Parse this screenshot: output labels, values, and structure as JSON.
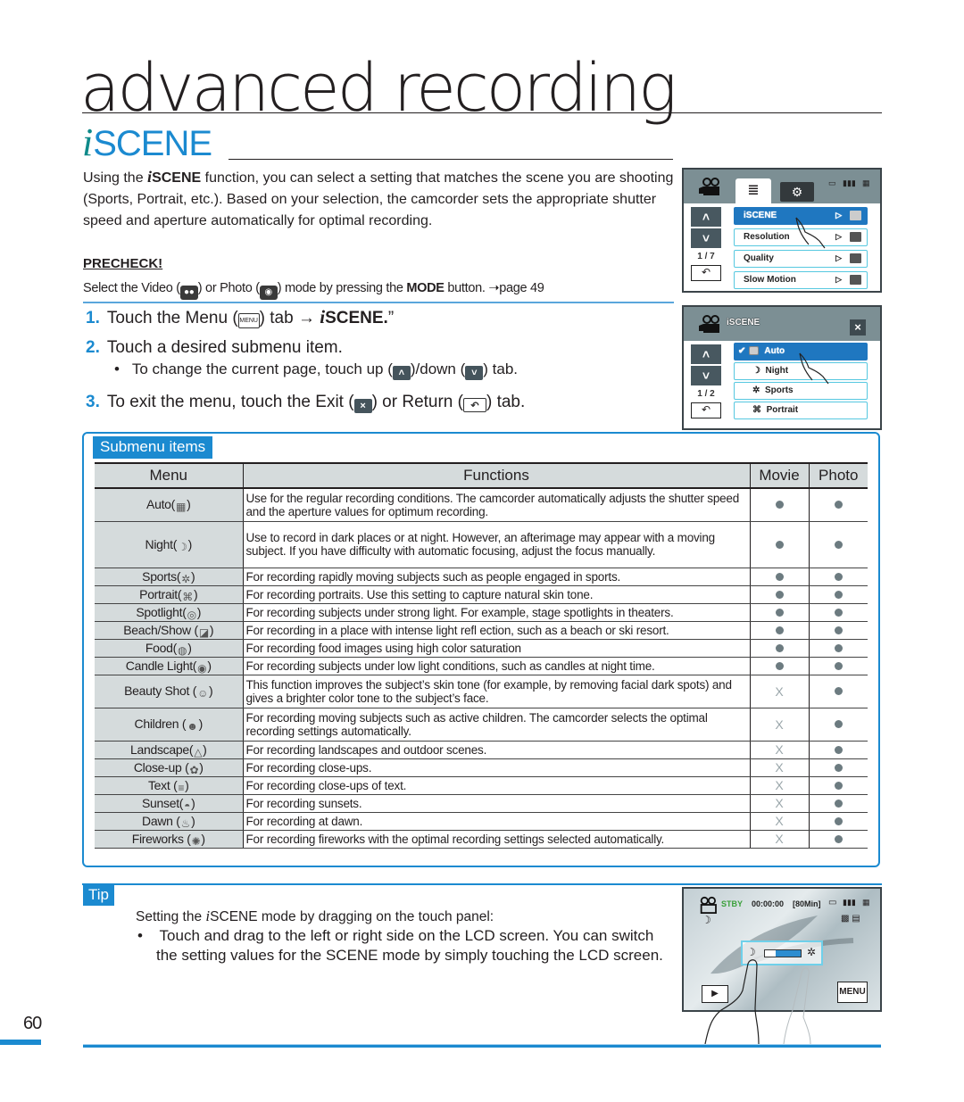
{
  "chapter_title": "advanced recording",
  "section": {
    "prefix": "i",
    "title": "SCENE"
  },
  "intro": {
    "part1": "Using the ",
    "brand_i": "i",
    "brand": "SCENE",
    "part2": " function, you can select a setting that matches the scene you are shooting (Sports, Portrait, etc.). Based on your selection, the camcorder sets the appropriate shutter speed and aperture automatically for optimal recording."
  },
  "precheck": {
    "title": "PRECHECK!",
    "text1": "Select the Video (",
    "video_icon": "video-camera-icon",
    "text2": ") or Photo (",
    "photo_icon": "camera-icon",
    "text3": ") mode by pressing the ",
    "mode": "MODE",
    "text4": " button. ",
    "page_ref": "➝page 49"
  },
  "steps": [
    {
      "num": "1.",
      "text1": "Touch the Menu (",
      "menu_icon_label": "MENU",
      "text2": ") tab → ",
      "brand_i": "i",
      "brand": "SCENE.",
      "text3": "”"
    },
    {
      "num": "2.",
      "text": "Touch a desired submenu item.",
      "bullet": {
        "text1": "To change the current page, touch up (",
        "up": "˄",
        "text2": ")/down (",
        "down": "˅",
        "text3": ") tab."
      }
    },
    {
      "num": "3.",
      "text1": "To exit the menu, touch the Exit (",
      "exit": "×",
      "text2": ") or Return (",
      "return": "↶",
      "text3": ") tab."
    }
  ],
  "lcd_menu": {
    "page": "1 / 7",
    "items": [
      {
        "label": "iSCENE",
        "selected": true
      },
      {
        "label": "Resolution",
        "selected": false
      },
      {
        "label": "Quality",
        "selected": false
      },
      {
        "label": "Slow Motion",
        "selected": false
      }
    ],
    "arrow": "▷",
    "up": "˄",
    "down": "˅",
    "return": "↶",
    "list_tab": "≣",
    "settings_tab": "⚙"
  },
  "lcd_scene": {
    "title": "iSCENE",
    "page": "1 / 2",
    "exit": "×",
    "items": [
      {
        "label": "Auto",
        "checked": true,
        "selected": true
      },
      {
        "label": "Night",
        "checked": false,
        "selected": false
      },
      {
        "label": "Sports",
        "checked": false,
        "selected": false
      },
      {
        "label": "Portrait",
        "checked": false,
        "selected": false
      }
    ],
    "check": "✔",
    "up": "˄",
    "down": "˅",
    "return": "↶"
  },
  "submenu": {
    "label": "Submenu items",
    "headers": [
      "Menu",
      "Functions",
      "Movie",
      "Photo"
    ],
    "rows": [
      {
        "menu": "Auto",
        "icon": "auto-scene-icon",
        "function": "Use for the regular recording conditions. The camcorder automatically adjusts the shutter speed and the aperture values for optimum recording.",
        "movie": "supported",
        "photo": "supported"
      },
      {
        "menu": "Night",
        "icon": "night-icon",
        "function": "Use to record in dark places or at night. However, an afterimage may appear with a moving subject. If you have difficulty with automatic focusing, adjust the focus manually.",
        "movie": "supported",
        "photo": "supported"
      },
      {
        "menu": "Sports",
        "icon": "sports-icon",
        "function": "For recording rapidly moving subjects such as people engaged in sports.",
        "movie": "supported",
        "photo": "supported"
      },
      {
        "menu": "Portrait",
        "icon": "portrait-icon",
        "function": "For recording portraits. Use this setting to capture natural skin tone.",
        "movie": "supported",
        "photo": "supported"
      },
      {
        "menu": "Spotlight",
        "icon": "spotlight-icon",
        "function": "For recording subjects under strong light. For example, stage spotlights in theaters.",
        "movie": "supported",
        "photo": "supported"
      },
      {
        "menu": "Beach/Show ",
        "icon": "beach-snow-icon",
        "function": "For recording in a place with intense light refl ection, such as a beach or ski resort.",
        "movie": "supported",
        "photo": "supported"
      },
      {
        "menu": "Food",
        "icon": "food-icon",
        "function": "For recording food images using high color saturation",
        "movie": "supported",
        "photo": "supported"
      },
      {
        "menu": "Candle Light",
        "icon": "candle-light-icon",
        "function": "For recording subjects under low light conditions, such as candles at night time.",
        "movie": "supported",
        "photo": "supported"
      },
      {
        "menu": "Beauty Shot ",
        "icon": "beauty-shot-icon",
        "function": "This function improves the subject’s skin tone (for example, by removing facial dark spots) and gives a brighter color tone to the subject’s face.",
        "movie": "not_supported",
        "photo": "supported"
      },
      {
        "menu": "Children ",
        "icon": "children-icon",
        "function": "For recording moving subjects such as active children. The camcorder selects the optimal recording settings automatically.",
        "movie": "not_supported",
        "photo": "supported"
      },
      {
        "menu": "Landscape",
        "icon": "landscape-icon",
        "function": "For recording landscapes and outdoor scenes.",
        "movie": "not_supported",
        "photo": "supported"
      },
      {
        "menu": "Close-up ",
        "icon": "close-up-icon",
        "function": "For recording close-ups.",
        "movie": "not_supported",
        "photo": "supported"
      },
      {
        "menu": "Text ",
        "icon": "text-icon",
        "function": "For recording close-ups of text.",
        "movie": "not_supported",
        "photo": "supported"
      },
      {
        "menu": "Sunset",
        "icon": "sunset-icon",
        "function": "For recording sunsets.",
        "movie": "not_supported",
        "photo": "supported"
      },
      {
        "menu": "Dawn ",
        "icon": "dawn-icon",
        "function": "For recording at dawn.",
        "movie": "not_supported",
        "photo": "supported"
      },
      {
        "menu": "Fireworks ",
        "icon": "fireworks-icon",
        "function": "For recording fireworks with the optimal recording settings selected automatically.",
        "movie": "not_supported",
        "photo": "supported"
      }
    ],
    "not_supported_mark": "X"
  },
  "tip": {
    "label": "Tip",
    "title1": "Setting the ",
    "brand_i": "i",
    "title2": "SCENE mode by dragging on the touch panel:",
    "bullet": "Touch and drag to the left or right side on the LCD screen. You can switch the setting values for the SCENE mode by simply touching the LCD screen."
  },
  "lcd_live": {
    "status": "STBY",
    "timecode": "00:00:00",
    "remaining": "[80Min]",
    "play": "▶",
    "menu": "MENU"
  },
  "page_number": "60",
  "colors": {
    "accent": "#1b8ad0",
    "table_header_bg": "#d5dbdc",
    "lcd_header": "#7c8f94",
    "lcd_selected": "#1f77c0",
    "stby_green": "#3aa03a"
  }
}
